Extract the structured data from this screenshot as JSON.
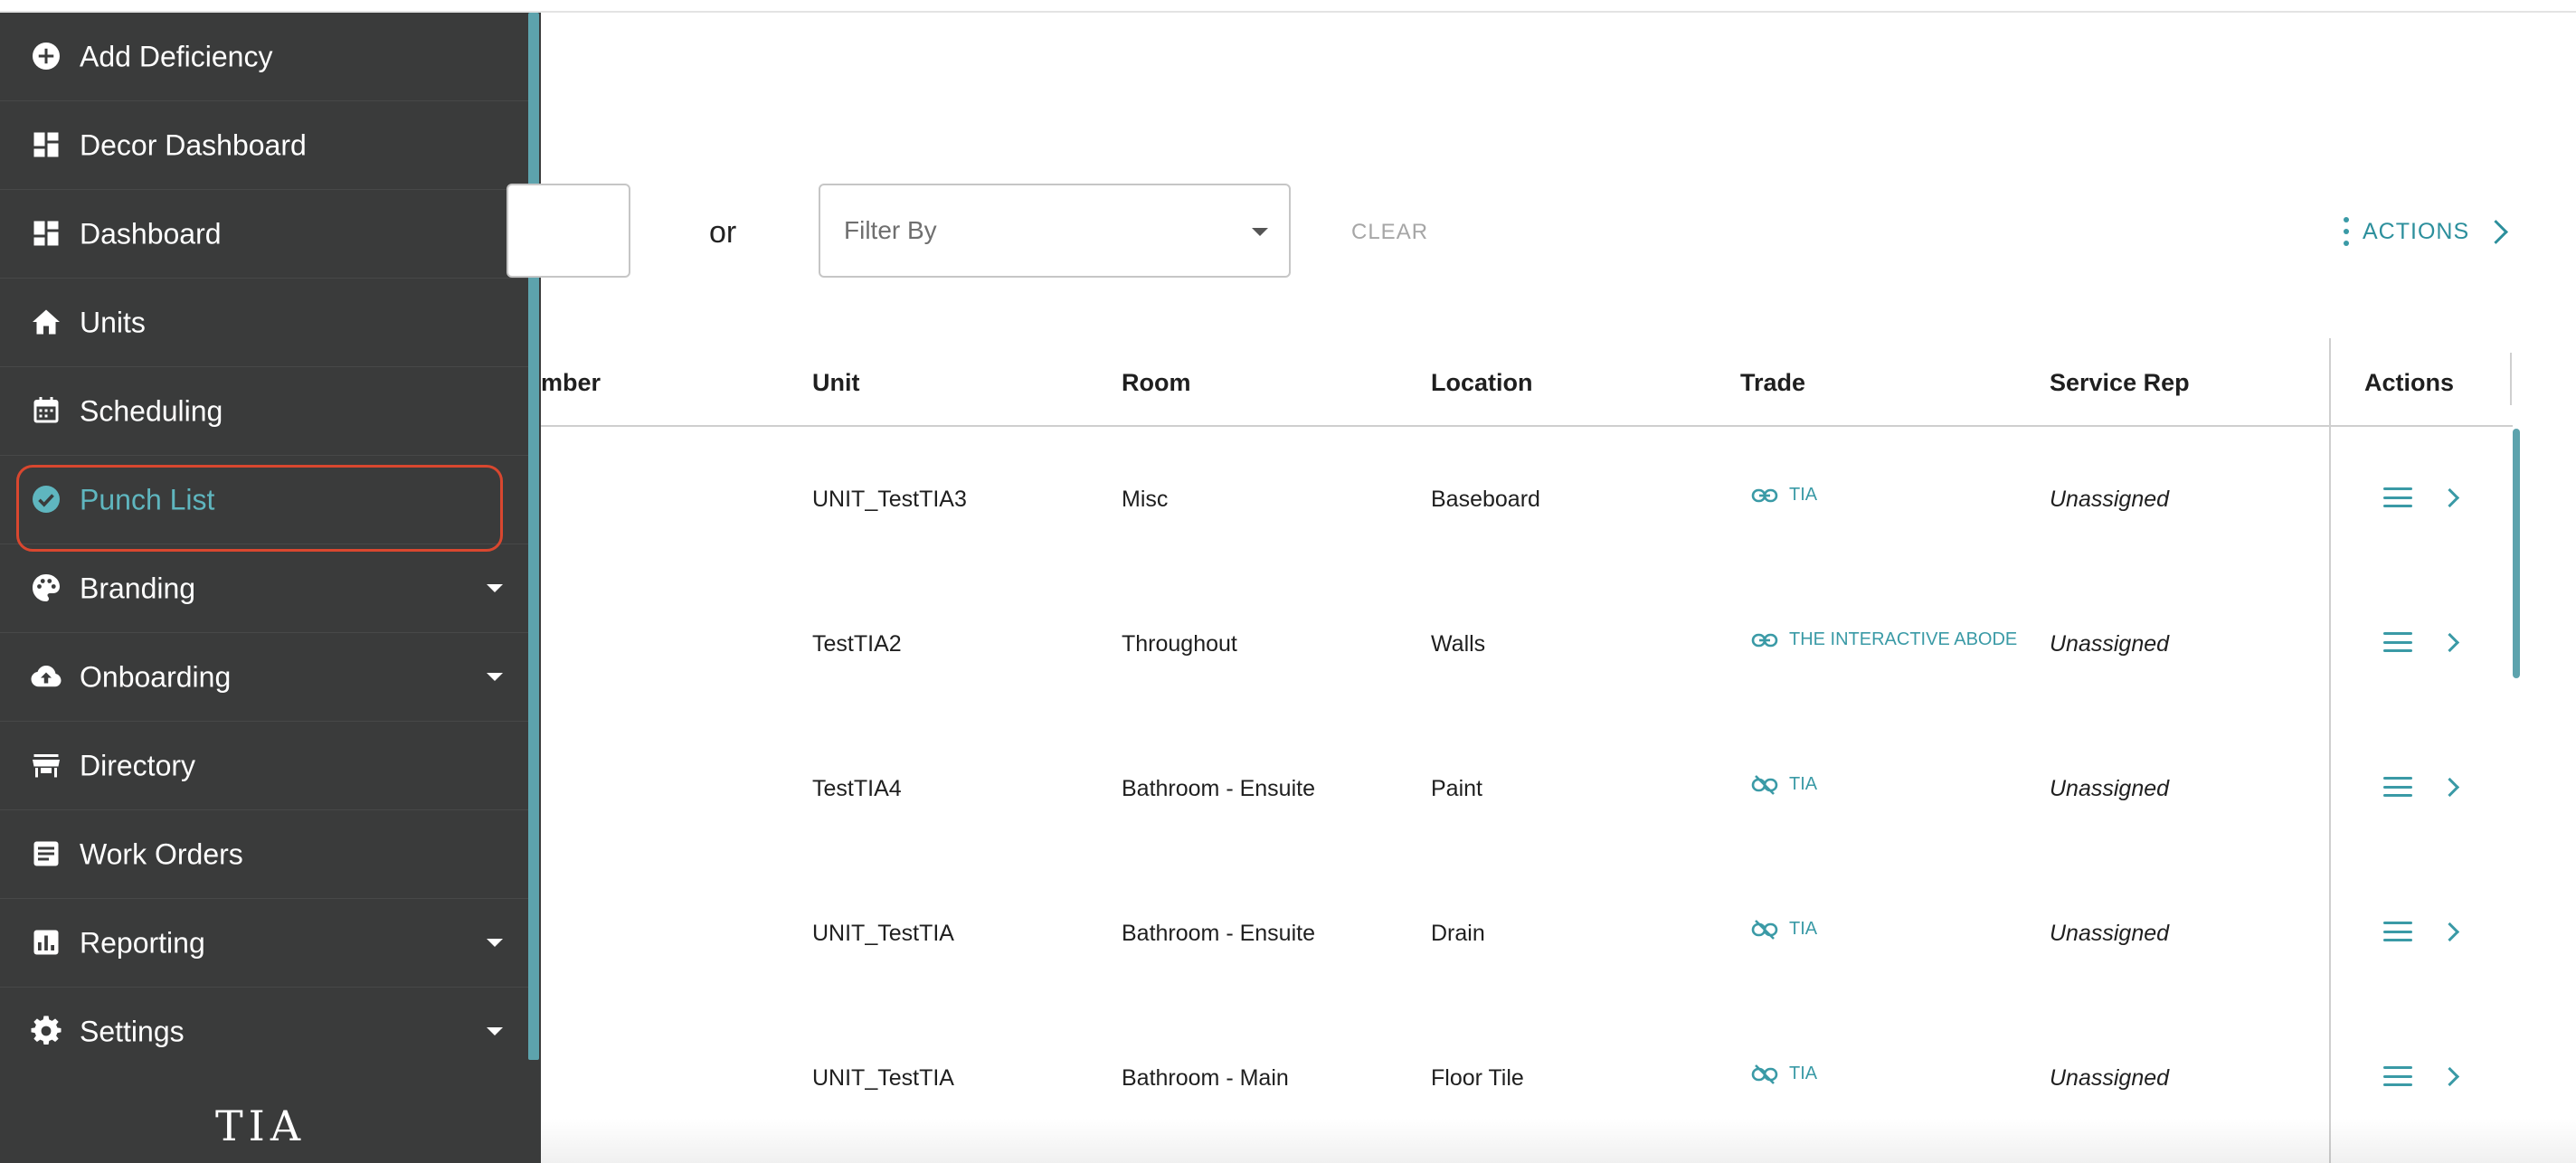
{
  "sidebar": {
    "items": [
      {
        "label": "Add Deficiency",
        "icon": "plus-circle-icon"
      },
      {
        "label": "Decor Dashboard",
        "icon": "dashboard-icon"
      },
      {
        "label": "Dashboard",
        "icon": "dashboard-icon"
      },
      {
        "label": "Units",
        "icon": "home-icon"
      },
      {
        "label": "Scheduling",
        "icon": "calendar-icon"
      },
      {
        "label": "Punch List",
        "icon": "check-circle-icon",
        "active": true
      },
      {
        "label": "Branding",
        "icon": "palette-icon",
        "expandable": true
      },
      {
        "label": "Onboarding",
        "icon": "cloud-upload-icon",
        "expandable": true
      },
      {
        "label": "Directory",
        "icon": "storefront-icon"
      },
      {
        "label": "Work Orders",
        "icon": "document-icon"
      },
      {
        "label": "Reporting",
        "icon": "chart-icon",
        "expandable": true
      },
      {
        "label": "Settings",
        "icon": "gear-icon",
        "expandable": true
      }
    ],
    "logo": "TIA"
  },
  "toolbar": {
    "or_label": "or",
    "filter_placeholder": "Filter By",
    "clear_label": "CLEAR",
    "actions_label": "ACTIONS"
  },
  "table": {
    "headers": {
      "number": "mber",
      "unit": "Unit",
      "room": "Room",
      "location": "Location",
      "trade": "Trade",
      "service_rep": "Service Rep",
      "actions": "Actions"
    },
    "rows": [
      {
        "unit": "UNIT_TestTIA3",
        "room": "Misc",
        "location": "Baseboard",
        "trade": "TIA",
        "trade_linked": true,
        "service_rep": "Unassigned"
      },
      {
        "unit": "TestTIA2",
        "room": "Throughout",
        "location": "Walls",
        "trade": "THE INTERACTIVE ABODE",
        "trade_linked": true,
        "service_rep": "Unassigned"
      },
      {
        "unit": "TestTIA4",
        "room": "Bathroom - Ensuite",
        "location": "Paint",
        "trade": "TIA",
        "trade_linked": false,
        "service_rep": "Unassigned"
      },
      {
        "unit": "UNIT_TestTIA",
        "room": "Bathroom - Ensuite",
        "location": "Drain",
        "trade": "TIA",
        "trade_linked": false,
        "service_rep": "Unassigned"
      },
      {
        "unit": "UNIT_TestTIA",
        "room": "Bathroom - Main",
        "location": "Floor Tile",
        "trade": "TIA",
        "trade_linked": false,
        "service_rep": "Unassigned"
      }
    ]
  },
  "colors": {
    "sidebar_bg": "#3a3b3b",
    "accent": "#3a9aa6",
    "highlight": "#d9472f"
  }
}
